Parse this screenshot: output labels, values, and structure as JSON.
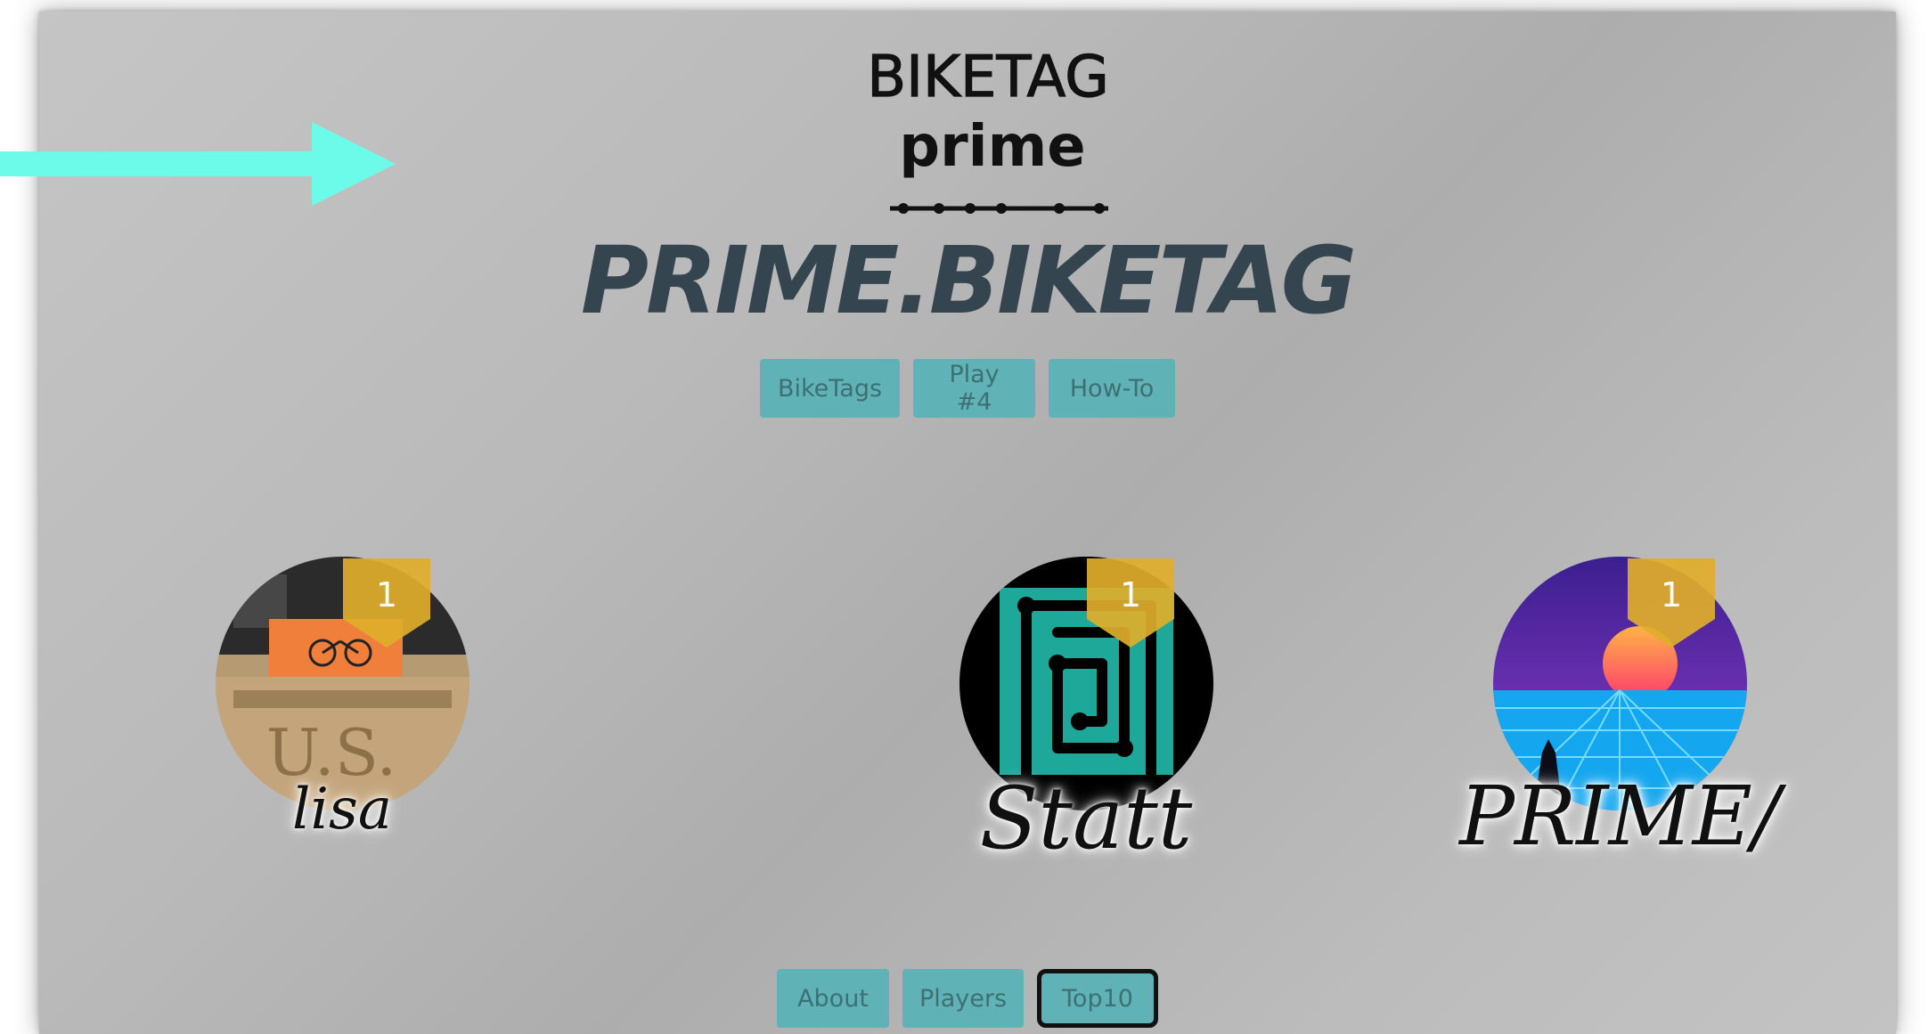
{
  "logo": {
    "line1": "BIKETAG",
    "line2": "prime"
  },
  "site_title": "PRIME.BIKETAG",
  "top_nav": [
    "BikeTags",
    "Play #4",
    "How-To"
  ],
  "players": [
    {
      "name": "lisa",
      "rank": "1"
    },
    {
      "name": "Statt",
      "rank": "1"
    },
    {
      "name": "PRIME/",
      "rank": "1"
    }
  ],
  "bottom_nav": [
    "About",
    "Players",
    "Top10"
  ],
  "active_bottom_nav": "Top10",
  "colors": {
    "button_bg": "#5fb3b6",
    "button_text": "#3d6f73",
    "title": "#34454f",
    "badge": "#e0ae2a",
    "arrow": "#6dfbe9"
  },
  "icons": {
    "pointer": "arrow-right-icon",
    "badge": "ribbon-badge-icon"
  }
}
